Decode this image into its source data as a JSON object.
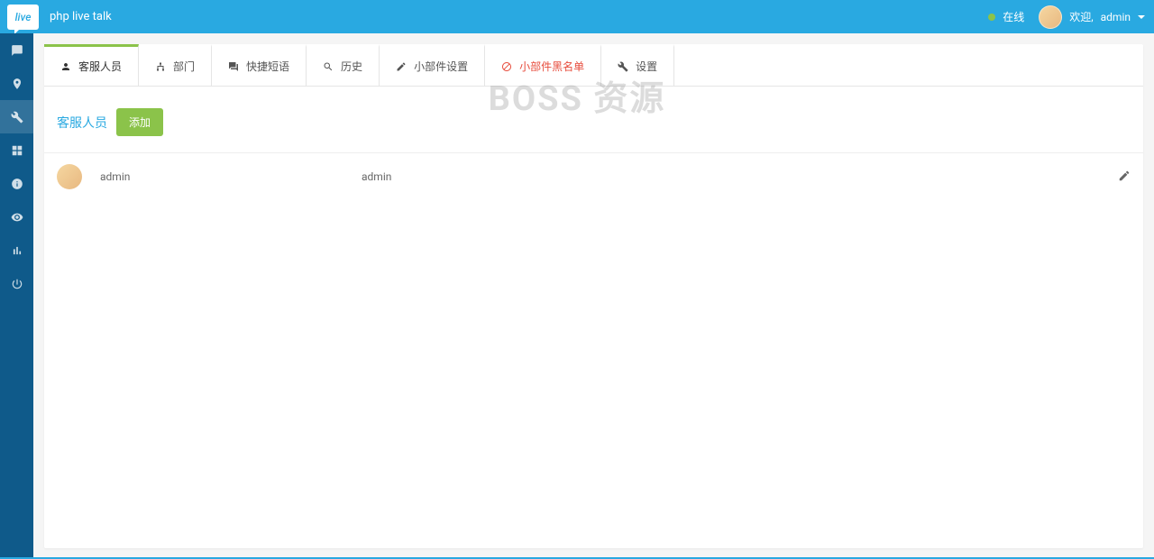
{
  "header": {
    "app_title": "php live talk",
    "logo_text": "live",
    "status_label": "在线",
    "welcome_prefix": "欢迎,",
    "username": "admin"
  },
  "sidebar": {
    "items": [
      {
        "name": "chat",
        "icon": "comment"
      },
      {
        "name": "location",
        "icon": "map-marker"
      },
      {
        "name": "tools",
        "icon": "wrench"
      },
      {
        "name": "grid",
        "icon": "grid"
      },
      {
        "name": "info",
        "icon": "info-circle"
      },
      {
        "name": "eye",
        "icon": "eye"
      },
      {
        "name": "reports",
        "icon": "bar-chart"
      },
      {
        "name": "power",
        "icon": "power-off"
      }
    ],
    "active_index": 2
  },
  "tabs": [
    {
      "label": "客服人员",
      "icon": "user"
    },
    {
      "label": "部门",
      "icon": "sitemap"
    },
    {
      "label": "快捷短语",
      "icon": "comments"
    },
    {
      "label": "历史",
      "icon": "search"
    },
    {
      "label": "小部件设置",
      "icon": "pencil"
    },
    {
      "label": "小部件黑名单",
      "icon": "ban",
      "warn": true
    },
    {
      "label": "设置",
      "icon": "wrench"
    }
  ],
  "active_tab": 0,
  "page": {
    "title": "客服人员",
    "add_button": "添加"
  },
  "operators": [
    {
      "display_name": "admin",
      "username": "admin"
    }
  ],
  "watermark": "BOSS 资源"
}
